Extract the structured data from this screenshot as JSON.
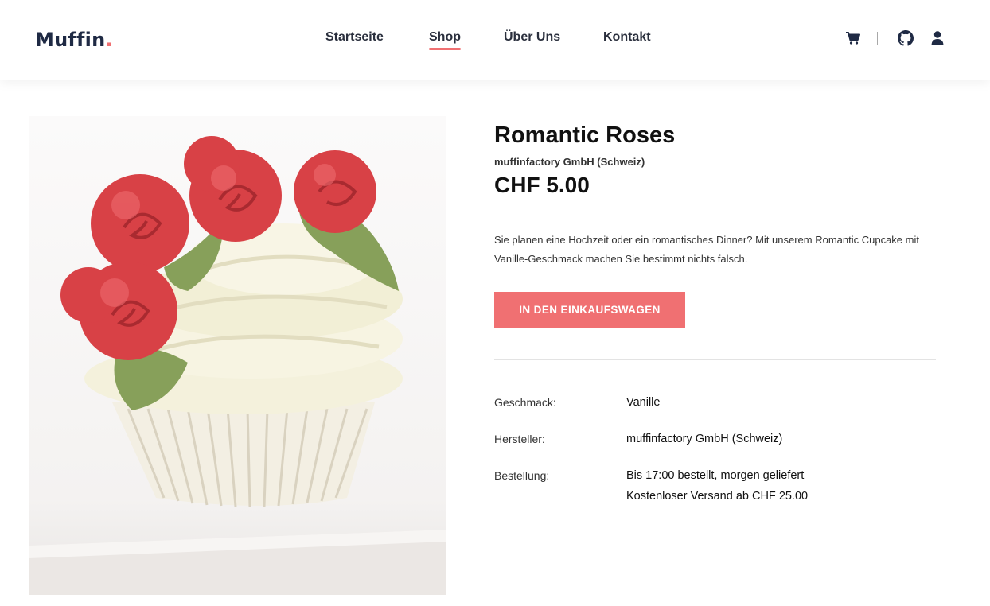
{
  "brand": {
    "name": "Muffin",
    "dot": ".",
    "accent": "#f07072"
  },
  "nav": {
    "items": [
      {
        "label": "Startseite"
      },
      {
        "label": "Shop"
      },
      {
        "label": "Über Uns"
      },
      {
        "label": "Kontakt"
      }
    ],
    "active": "Shop"
  },
  "header_icons": [
    "cart-icon",
    "github-icon",
    "user-icon"
  ],
  "product": {
    "title": "Romantic Roses",
    "manufacturer": "muffinfactory GmbH (Schweiz)",
    "price": "CHF 5.00",
    "description": "Sie planen eine Hochzeit oder ein romantisches Dinner? Mit unserem Romantic Cupcake mit Vanille-Geschmack machen Sie bestimmt nichts falsch.",
    "add_to_cart_label": "IN DEN EINKAUFSWAGEN",
    "image_subject": "cupcake-with-red-fondant-roses"
  },
  "specs": [
    {
      "label": "Geschmack:",
      "values": [
        "Vanille"
      ]
    },
    {
      "label": "Hersteller:",
      "values": [
        "muffinfactory GmbH (Schweiz)"
      ]
    },
    {
      "label": "Bestellung:",
      "values": [
        "Bis 17:00 bestellt, morgen geliefert",
        "Kostenloser Versand ab CHF 25.00"
      ]
    }
  ]
}
